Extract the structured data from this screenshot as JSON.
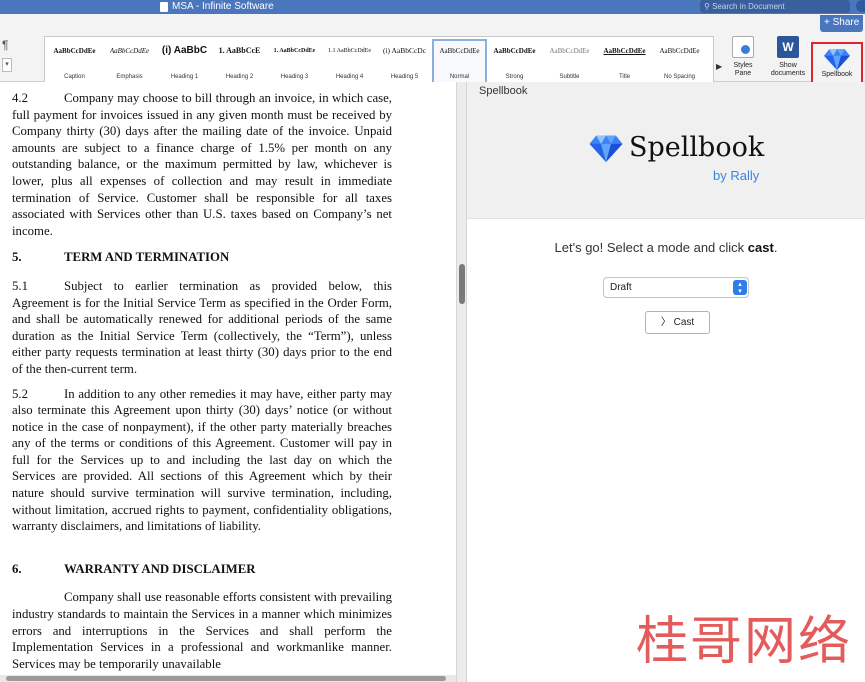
{
  "window": {
    "title": "MSA - Infinite Software",
    "search_placeholder": "Search in Document",
    "share_label": "Share"
  },
  "ribbon": {
    "paragraph_mark": "¶",
    "styles": [
      {
        "preview": "AaBbCcDdEe",
        "name": "Caption"
      },
      {
        "preview": "AaBbCcDdEe",
        "name": "Emphasis"
      },
      {
        "preview": "(i) AaBbC",
        "name": "Heading 1"
      },
      {
        "preview": "1. AaBbCcE",
        "name": "Heading 2"
      },
      {
        "preview": "1. AaBbCcDdEe",
        "name": "Heading 3"
      },
      {
        "preview": "1.1 AaBbCcDdEe",
        "name": "Heading 4"
      },
      {
        "preview": "(i) AaBbCcDc",
        "name": "Heading 5"
      },
      {
        "preview": "AaBbCcDdEe",
        "name": "Normal"
      },
      {
        "preview": "AaBbCcDdEe",
        "name": "Strong"
      },
      {
        "preview": "AaBbCcDdEe",
        "name": "Subtitle"
      },
      {
        "preview": "AaBbCcDdEe",
        "name": "Title"
      },
      {
        "preview": "AaBbCcDdEe",
        "name": "No Spacing"
      }
    ],
    "active_style": "Normal",
    "styles_pane_label": "Styles Pane",
    "show_documents_label": "Show documents",
    "show_documents_icon": "W",
    "spellbook_label": "Spellbook"
  },
  "document": {
    "p42_num": "4.2",
    "p42_text": "Company may choose to bill through an invoice, in which case, full payment for invoices issued in any given month must be received by Company thirty (30) days after the mailing date of the invoice. Unpaid amounts are subject to a finance charge of 1.5% per month on any outstanding balance, or the maximum permitted by law, whichever is lower, plus all expenses of collection and may result in immediate termination of Service. Customer shall be responsible for all taxes associated with Services other than U.S. taxes based on Company’s net income.",
    "s5_num": "5.",
    "s5_title": "TERM AND TERMINATION",
    "p51_num": "5.1",
    "p51_text": "Subject to earlier termination as provided below, this Agreement is for the Initial Service Term as specified in the Order Form, and shall be automatically renewed for additional periods of the same duration as the Initial Service Term (collectively, the “Term”), unless either party requests termination at least thirty (30) days prior to the end of the then-current term.",
    "p52_num": "5.2",
    "p52_text": "In addition to any other remedies it may have, either party may also terminate this Agreement upon thirty (30) days’ notice (or without notice in the case of nonpayment), if the other party materially breaches any of the terms or conditions of this Agreement. Customer will pay in full for the Services up to and including the last day on which the Services are provided. All sections of this Agreement which by their nature should survive termination will survive termination, including, without limitation, accrued rights to payment, confidentiality obligations, warranty disclaimers, and limitations of liability.",
    "s6_num": "6.",
    "s6_title": "WARRANTY AND DISCLAIMER",
    "p6_text": "Company shall use reasonable efforts consistent with prevailing industry standards to maintain the Services in a manner which minimizes errors and interruptions in the Services and shall perform the Implementation Services in a professional and workmanlike manner. Services may be temporarily unavailable"
  },
  "spellbook_pane": {
    "pane_title": "Spellbook",
    "logo_text": "Spellbook",
    "byline": "by Rally",
    "prompt_lead": "Let's go! Select a mode and click ",
    "prompt_bold": "cast",
    "prompt_end": ".",
    "mode_value": "Draft",
    "cast_label": "Cast",
    "cast_icon": "chevron-right-icon",
    "gem_color": "#3b82f6"
  },
  "watermark": "桂哥网络"
}
